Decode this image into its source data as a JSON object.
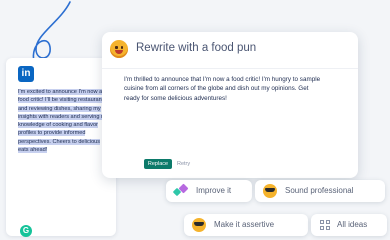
{
  "colors": {
    "doodle": "#2c6fd1",
    "linkedin": "#0a66c2",
    "highlight": "#c7d0ef",
    "replace": "#0c7a6a",
    "grammarly": "#15c39a"
  },
  "linkedin_post": {
    "icon": "linkedin-icon",
    "logo_text": "in",
    "text": "I'm excited to announce I'm now a food critic! I'll be visiting restaurants and reviewing dishes, sharing my insights with readers and serving my knowledge of cooking and flavor profiles to provide informed perspectives. Cheers to delicious eats ahead!"
  },
  "rewrite_popup": {
    "prompt": "Rewrite with a food pun",
    "result": "I'm thrilled to announce that I'm now a food critic! I'm hungry to sample cuisine from all corners of the globe and dish out my opinions. Get ready for some delicious adventures!",
    "replace_label": "Replace",
    "retry_label": "Retry"
  },
  "suggestions": {
    "improve": "Improve it",
    "professional": "Sound professional",
    "assertive": "Make it assertive",
    "all_ideas": "All ideas"
  },
  "grammarly_logo": "G"
}
